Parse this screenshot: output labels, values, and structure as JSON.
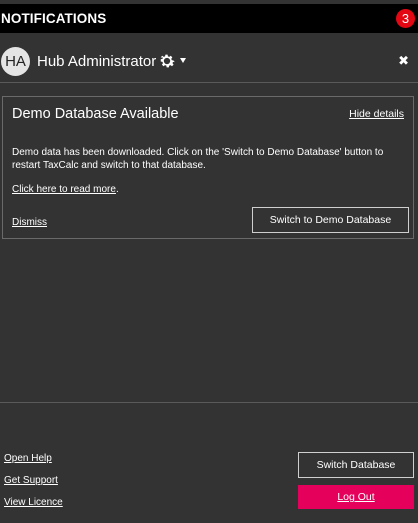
{
  "header": {
    "title": "NOTIFICATIONS",
    "badge_count": "3"
  },
  "user": {
    "initials": "HA",
    "name": "Hub Administrator",
    "settings_icon": "gear-icon",
    "dropdown_icon": "caret-down-icon",
    "close_icon": "close-icon",
    "close_glyph": "✖"
  },
  "notification": {
    "title": "Demo Database Available",
    "hide_label": "Hide details",
    "body": "Demo data has been downloaded. Click on the 'Switch to Demo Database' button to restart TaxCalc and switch to that database.",
    "read_more_label": "Click here to read more",
    "read_more_suffix": ".",
    "dismiss_label": "Dismiss",
    "action_label": "Switch to Demo Database"
  },
  "footer": {
    "links": [
      "Open Help",
      "Get Support",
      "View Licence"
    ],
    "switch_db_label": "Switch Database",
    "logout_label": "Log Out"
  },
  "colors": {
    "background": "#333333",
    "header": "#000000",
    "badge": "#e30613",
    "logout": "#e5005b"
  }
}
